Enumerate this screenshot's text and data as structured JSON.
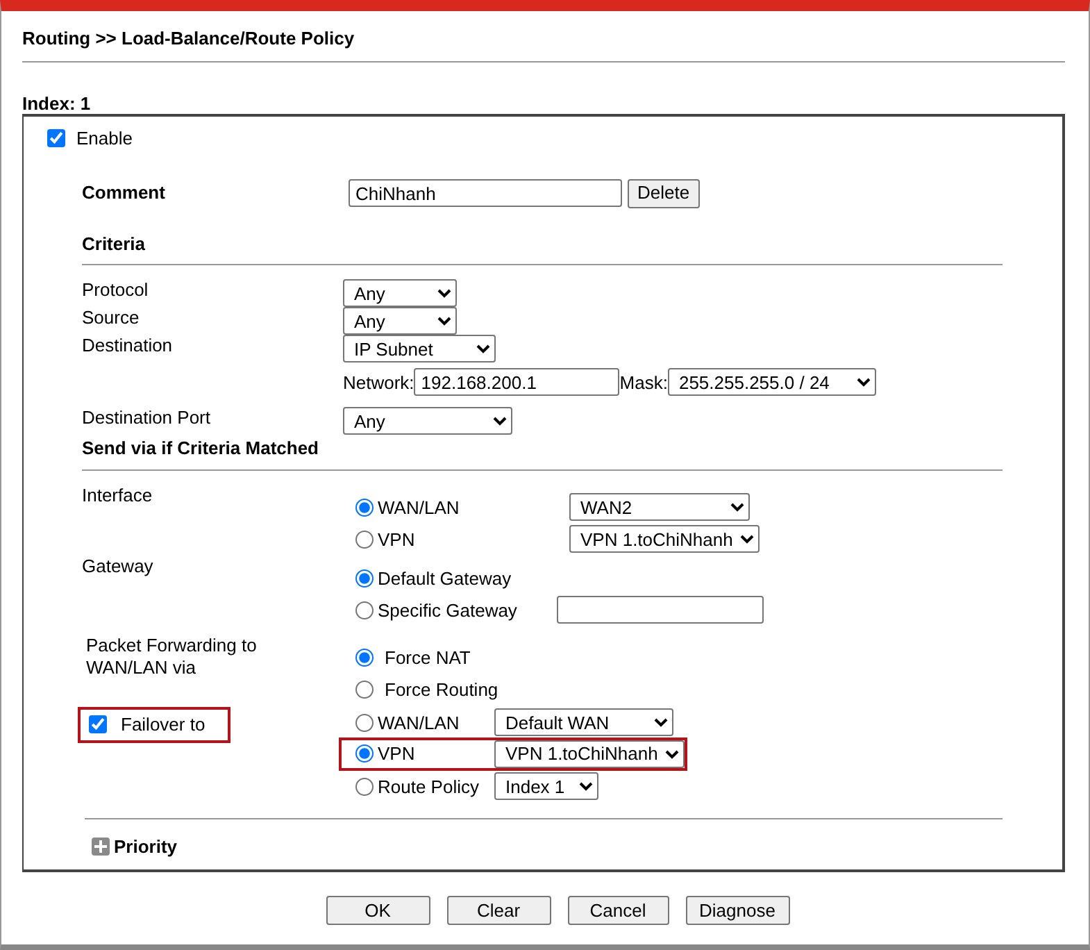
{
  "title": "Routing >> Load-Balance/Route Policy",
  "index_label": "Index: 1",
  "enable": {
    "label": "Enable",
    "checked": true
  },
  "comment": {
    "label": "Comment",
    "value": "ChiNhanh",
    "button": "Delete"
  },
  "criteria": {
    "heading": "Criteria",
    "rows": [
      {
        "kind": "select",
        "label": "Protocol",
        "value": "Any"
      },
      {
        "kind": "select",
        "label": "Source",
        "value": "Any"
      },
      {
        "kind": "subnet",
        "label": "Destination",
        "value": "IP Subnet",
        "network_label": "Network:",
        "network": "192.168.200.1",
        "mask_label": "Mask:",
        "mask": "255.255.255.0 / 24"
      },
      {
        "kind": "select",
        "label": "Destination Port",
        "value": "Any"
      }
    ]
  },
  "send_via": {
    "heading": "Send via if Criteria Matched",
    "groups": [
      {
        "label": "Interface",
        "options": [
          {
            "label": "WAN/LAN",
            "selected": true,
            "kind": "select",
            "value": "WAN2"
          },
          {
            "label": "VPN",
            "selected": false,
            "kind": "select",
            "value": "VPN 1.toChiNhanh"
          }
        ]
      },
      {
        "label": "Gateway",
        "options": [
          {
            "label": "Default Gateway",
            "selected": true,
            "kind": "plain"
          },
          {
            "label": "Specific Gateway",
            "selected": false,
            "kind": "field"
          }
        ]
      },
      {
        "label": "Packet Forwarding to WAN/LAN via",
        "options": [
          {
            "label": "Force NAT",
            "selected": true,
            "kind": "plain"
          },
          {
            "label": "Force Routing",
            "selected": false,
            "kind": "plain"
          }
        ]
      },
      {
        "label": "Failover to",
        "checked": true,
        "highlighted": true,
        "options": [
          {
            "label": "WAN/LAN",
            "selected": false,
            "kind": "select",
            "value": "Default WAN",
            "highlighted": false
          },
          {
            "label": "VPN",
            "selected": true,
            "kind": "select",
            "value": "VPN 1.toChiNhanh",
            "highlighted": true
          },
          {
            "label": "Route Policy",
            "selected": false,
            "kind": "select",
            "value": "Index 1",
            "highlighted": false
          }
        ]
      }
    ]
  },
  "priority": {
    "label": "Priority",
    "expanded": false
  },
  "buttons": [
    "OK",
    "Clear",
    "Cancel",
    "Diagnose"
  ]
}
